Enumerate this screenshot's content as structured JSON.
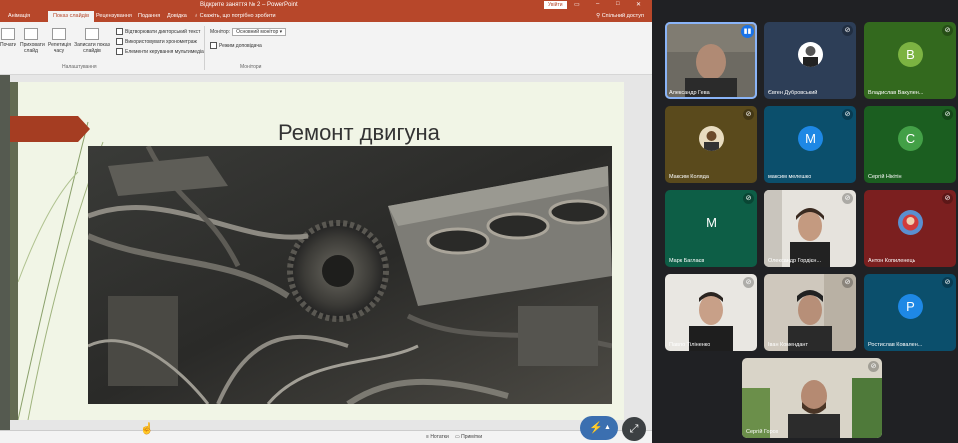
{
  "powerpoint": {
    "window_title": "Відкрите заняття № 2 – PowerPoint",
    "login_label": "Увійти",
    "tabs": [
      "Анімація",
      "Показ слайдів",
      "Рецензування",
      "Подання",
      "Довідка",
      "Скажіть, що потрібно зробити"
    ],
    "share_label": "Спільний доступ",
    "ribbon": {
      "btn1": "Почати спочатку",
      "btn2": "Приховати слайд",
      "btn3": "Репетиція часу",
      "btn4": "Записати показ слайдів",
      "check1": "Відтворювати дикторський текст",
      "check2": "Використовувати хронометраж",
      "check3": "Елементи керування мультимедіа",
      "group_setup": "Налаштування",
      "monitor_label": "Монітор:",
      "monitor_value": "Основний монітор",
      "presenter_view": "Режим доповідача",
      "group_monitors": "Монітори"
    },
    "slide": {
      "title": "Ремонт двигуна"
    },
    "status": {
      "notes": "Нотатки",
      "comments": "Примітки"
    }
  },
  "meet": {
    "participants": [
      {
        "name": "Александр Гева",
        "type": "video",
        "speaking": true
      },
      {
        "name": "Євген Дубровський",
        "type": "photo",
        "bg": "#2d3e57",
        "mic": "muted"
      },
      {
        "name": "Владислав Вакулен...",
        "type": "letter",
        "letter": "B",
        "bg": "#33691e",
        "circle": "#7cb342",
        "mic": "muted"
      },
      {
        "name": "Максим Коляда",
        "type": "photo",
        "bg": "#5a4a1c",
        "mic": "muted"
      },
      {
        "name": "максим мелешко",
        "type": "letter",
        "letter": "M",
        "bg": "#0b4f6c",
        "circle": "#1e88e5",
        "mic": "muted"
      },
      {
        "name": "Сергій Нікітін",
        "type": "letter",
        "letter": "C",
        "bg": "#1b5e20",
        "circle": "#43a047",
        "mic": "muted"
      },
      {
        "name": "Марк Баглаєв",
        "type": "letter",
        "letter": "M",
        "bg": "#0d5e46",
        "circle": "",
        "mic": "muted"
      },
      {
        "name": "Олександр Гордієн...",
        "type": "video",
        "mic": "muted"
      },
      {
        "name": "Антон Копиленець",
        "type": "photo",
        "bg": "#7b1f1f",
        "mic": "muted"
      },
      {
        "name": "Павло Тіліненко",
        "type": "video",
        "mic": "muted"
      },
      {
        "name": "Іван Комендант",
        "type": "video",
        "mic": "muted"
      },
      {
        "name": "Ростислав Ковален...",
        "type": "letter",
        "letter": "P",
        "bg": "#0b4f6c",
        "circle": "#1e88e5",
        "mic": "muted"
      },
      {
        "name": "Сергій Горох",
        "type": "video",
        "mic": "muted"
      }
    ]
  },
  "icons": {
    "mic_off": "mic-off-icon",
    "speaking": "audio-wave-icon",
    "expand": "expand-icon",
    "pointer": "hand-cursor-icon"
  }
}
